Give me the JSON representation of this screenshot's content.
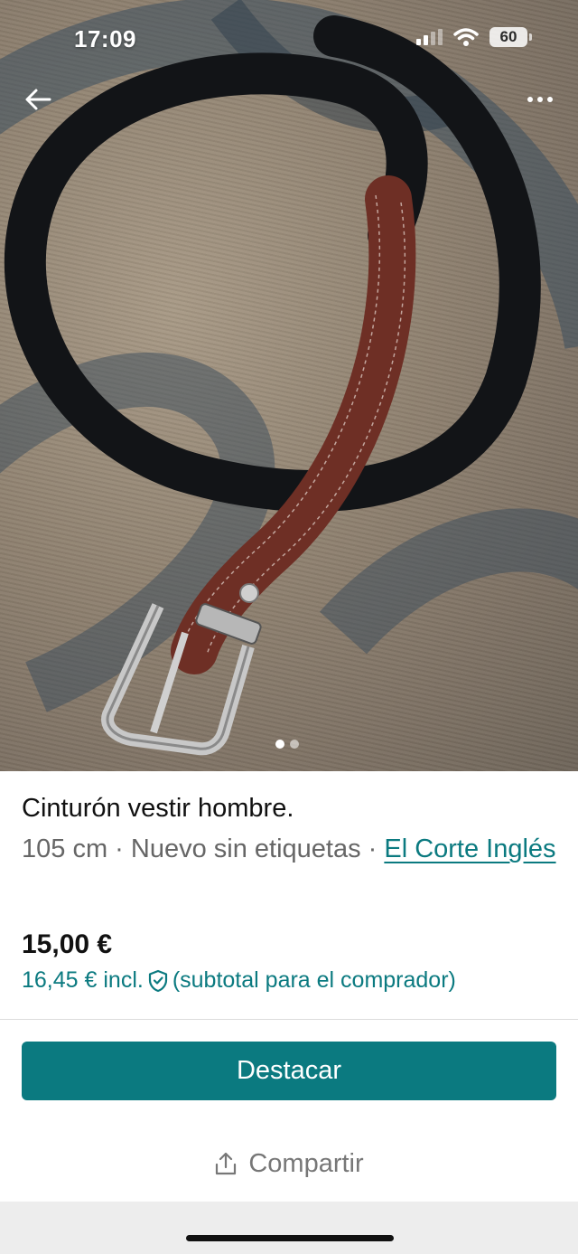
{
  "status_bar": {
    "time": "17:09",
    "battery": "60"
  },
  "icons": {
    "back": "arrow-left-icon",
    "more": "more-horizontal-icon",
    "shield": "shield-check-icon",
    "share": "share-upload-icon"
  },
  "gallery": {
    "image_count": 2,
    "active_index": 0
  },
  "product": {
    "title": "Cinturón vestir hombre.",
    "meta_prefix": "105 cm · Nuevo sin etiquetas · ",
    "brand": "El Corte Inglés",
    "price": "15,00 €",
    "price_incl_prefix": "16,45 € incl.",
    "price_incl_suffix": "(subtotal para el comprador)"
  },
  "actions": {
    "primary_label": "Destacar",
    "share_label": "Compartir"
  },
  "colors": {
    "accent": "#0b7a80",
    "muted_text": "#666666"
  }
}
